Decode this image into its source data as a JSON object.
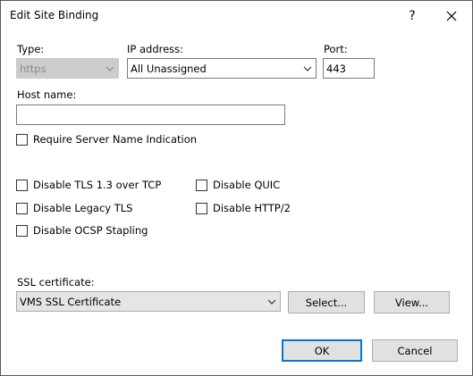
{
  "window": {
    "title": "Edit Site Binding",
    "help_label": "?"
  },
  "type": {
    "label": "Type:",
    "value": "https"
  },
  "ip": {
    "label": "IP address:",
    "value": "All Unassigned"
  },
  "port": {
    "label": "Port:",
    "value": "443"
  },
  "host": {
    "label": "Host name:",
    "value": ""
  },
  "sni": {
    "label": "Require Server Name Indication",
    "checked": false
  },
  "options": {
    "tls13": "Disable TLS 1.3 over TCP",
    "quic": "Disable QUIC",
    "legacy_tls": "Disable Legacy TLS",
    "http2": "Disable HTTP/2",
    "ocsp": "Disable OCSP Stapling"
  },
  "ssl": {
    "label": "SSL certificate:",
    "value": "VMS SSL Certificate",
    "select_label": "Select...",
    "view_label": "View..."
  },
  "footer": {
    "ok_label": "OK",
    "cancel_label": "Cancel"
  }
}
